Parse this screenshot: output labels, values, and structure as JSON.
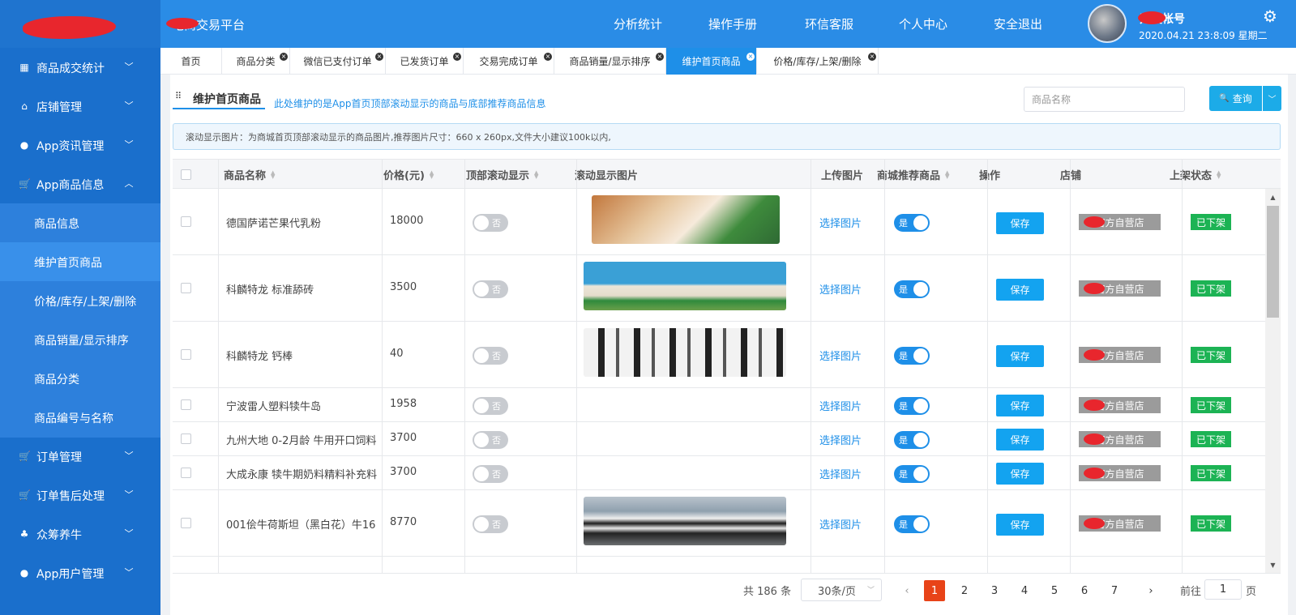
{
  "header": {
    "platform_title": "电商交易平台",
    "nav": [
      "分析统计",
      "操作手册",
      "环信客服",
      "个人中心",
      "安全退出"
    ],
    "user_name": "开发帐号",
    "user_time": "2020.04.21 23:8:09 星期二",
    "icons": {
      "settings": "gear-icon",
      "avatar": "avatar"
    },
    "colors": {
      "header": "#2a8ce6",
      "sidebar": "#1a6fcc",
      "accent": "#1e8fe8"
    }
  },
  "sidebar": {
    "items": [
      {
        "label": "商品成交统计",
        "icon": "chart-icon",
        "expanded": false
      },
      {
        "label": "店铺管理",
        "icon": "home-icon",
        "expanded": false
      },
      {
        "label": "App资讯管理",
        "icon": "chat-icon",
        "expanded": false
      },
      {
        "label": "App商品信息",
        "icon": "cart-icon",
        "expanded": true
      },
      {
        "label": "订单管理",
        "icon": "cart-icon",
        "expanded": false
      },
      {
        "label": "订单售后处理",
        "icon": "cart-icon",
        "expanded": false
      },
      {
        "label": "众筹养牛",
        "icon": "cow-icon",
        "expanded": false
      },
      {
        "label": "App用户管理",
        "icon": "user-icon",
        "expanded": false
      }
    ],
    "sub_items": [
      "商品信息",
      "维护首页商品",
      "价格/库存/上架/删除",
      "商品销量/显示排序",
      "商品分类",
      "商品编号与名称"
    ],
    "active_sub": "维护首页商品"
  },
  "tabs": [
    "首页",
    "商品分类",
    "微信已支付订单",
    "已发货订单",
    "交易完成订单",
    "商品销量/显示排序",
    "维护首页商品",
    "价格/库存/上架/删除"
  ],
  "active_tab": "维护首页商品",
  "page": {
    "title": "维护首页商品",
    "hint": "此处维护的是App首页顶部滚动显示的商品与底部推荐商品信息",
    "search_placeholder": "商品名称",
    "query_label": "查询",
    "notice": "滚动显示图片：为商城首页顶部滚动显示的商品图片,推荐图片尺寸：660 x 260px,文件大小建议100k以内,"
  },
  "table": {
    "columns": [
      "商品名称",
      "价格(元)",
      "顶部滚动显示",
      "滚动显示图片",
      "上传图片",
      "商城推荐商品",
      "操作",
      "店铺",
      "上架状态"
    ],
    "rows": [
      {
        "name": "德国萨诺芒果代乳粉",
        "price": "18000",
        "scroll": "否",
        "image": "calf",
        "upload": "选择图片",
        "recommend": "是",
        "action": "保存",
        "shop": "官方自营店",
        "status": "已下架"
      },
      {
        "name": "科麟特龙 标准舔砖",
        "price": "3500",
        "scroll": "否",
        "image": "kltl",
        "upload": "选择图片",
        "recommend": "是",
        "action": "保存",
        "shop": "官方自营店",
        "status": "已下架"
      },
      {
        "name": "科麟特龙 钙棒",
        "price": "40",
        "scroll": "否",
        "image": "kylin",
        "upload": "选择图片",
        "recommend": "是",
        "action": "保存",
        "shop": "官方自营店",
        "status": "已下架"
      },
      {
        "name": "宁波雷人塑料犊牛岛",
        "price": "1958",
        "scroll": "否",
        "image": "",
        "upload": "选择图片",
        "recommend": "是",
        "action": "保存",
        "shop": "官方自营店",
        "status": "已下架"
      },
      {
        "name": "九州大地 0-2月龄 牛用开口饲料",
        "price": "3700",
        "scroll": "否",
        "image": "",
        "upload": "选择图片",
        "recommend": "是",
        "action": "保存",
        "shop": "官方自营店",
        "status": "已下架"
      },
      {
        "name": "大成永康 犊牛期奶料精料补充料",
        "price": "3700",
        "scroll": "否",
        "image": "",
        "upload": "选择图片",
        "recommend": "是",
        "action": "保存",
        "shop": "官方自营店",
        "status": "已下架"
      },
      {
        "name": "001侩牛荷斯坦（黑白花）牛16",
        "price": "8770",
        "scroll": "否",
        "image": "barn",
        "upload": "选择图片",
        "recommend": "是",
        "action": "保存",
        "shop": "官方自营店",
        "status": "已下架"
      }
    ]
  },
  "pager": {
    "total": "共 186 条",
    "page_size": "30条/页",
    "pages": [
      "1",
      "2",
      "3",
      "4",
      "5",
      "6",
      "7"
    ],
    "current": "1",
    "goto_label": "前往",
    "goto_value": "1",
    "page_unit": "页"
  }
}
